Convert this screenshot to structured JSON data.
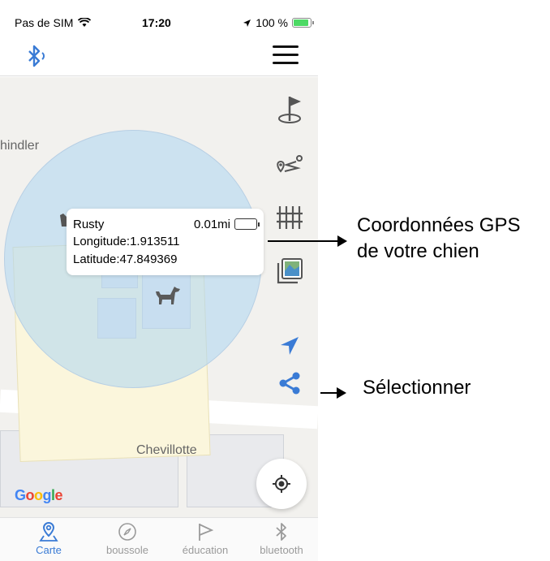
{
  "status": {
    "carrier": "Pas de SIM",
    "time": "17:20",
    "battery": "100 %"
  },
  "header": {
    "bluetooth_icon": "bluetooth-signal-icon",
    "menu_icon": "hamburger-menu-icon"
  },
  "map": {
    "label_street": "hindler",
    "label_place": "Chevillotte",
    "attribution": [
      "G",
      "o",
      "o",
      "g",
      "l",
      "e"
    ]
  },
  "popup": {
    "name": "Rusty",
    "distance": "0.01mi",
    "longitude": "Longitude:1.913511",
    "latitude": "Latitude:47.849369"
  },
  "side_buttons": [
    "flag-pin-icon",
    "route-icon",
    "fence-icon",
    "map-layer-icon",
    "navigate-arrow-icon",
    "share-icon"
  ],
  "tabs": [
    {
      "label": "Carte",
      "icon": "map-pin-icon",
      "active": true
    },
    {
      "label": "boussole",
      "icon": "compass-icon",
      "active": false
    },
    {
      "label": "éducation",
      "icon": "flag-icon",
      "active": false
    },
    {
      "label": "bluetooth",
      "icon": "bluetooth-icon",
      "active": false
    }
  ],
  "annotations": {
    "gps_line1": "Coordonnées GPS",
    "gps_line2": "de votre chien",
    "select": "Sélectionner"
  },
  "colors": {
    "accent": "#3a7bd5",
    "circle": "#add6f3"
  }
}
